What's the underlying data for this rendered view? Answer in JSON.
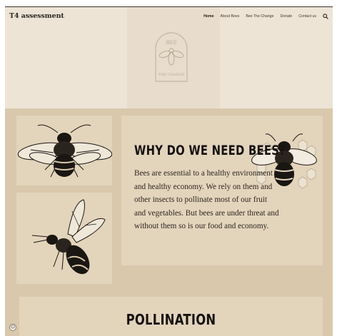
{
  "header": {
    "brand": "T4 assessment",
    "nav": [
      {
        "label": "Home",
        "active": true
      },
      {
        "label": "About Bees",
        "active": false
      },
      {
        "label": "Bee The Change",
        "active": false
      },
      {
        "label": "Donate",
        "active": false
      },
      {
        "label": "Contact us",
        "active": false
      }
    ],
    "search_icon": "search-icon"
  },
  "hero": {
    "logo_top": "BEE",
    "logo_bottom": "THE CHANGE"
  },
  "about": {
    "title": "WHY DO WE NEED BEES?",
    "paragraph": "Bees are essential to a healthy environment and healthy economy. We rely on them and other insects to pollinate most of our fruit and vegetables. But bees are under threat and without them so is our food and economy."
  },
  "pollination": {
    "title": "POLLINATION"
  },
  "colors": {
    "hero_bg": "#ede4d6",
    "main_bg": "#d9c8ac",
    "card_bg": "#e3d4bc",
    "text": "#15120f"
  }
}
